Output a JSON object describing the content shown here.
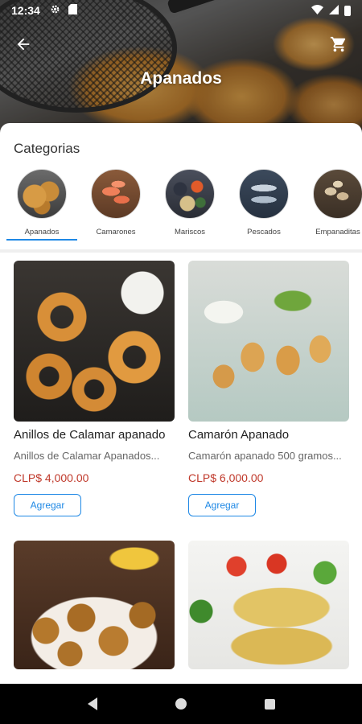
{
  "status_bar": {
    "time": "12:34"
  },
  "header": {
    "title": "Apanados"
  },
  "categories": {
    "heading": "Categorias",
    "items": [
      {
        "label": "Apanados",
        "selected": true
      },
      {
        "label": "Camarones",
        "selected": false
      },
      {
        "label": "Mariscos",
        "selected": false
      },
      {
        "label": "Pescados",
        "selected": false
      },
      {
        "label": "Empanaditas",
        "selected": false
      }
    ]
  },
  "products": [
    {
      "name": "Anillos de Calamar apanado",
      "description": "Anillos de Calamar Apanados...",
      "price": "CLP$ 4,000.00",
      "button": "Agregar"
    },
    {
      "name": "Camarón Apanado",
      "description": "Camarón apanado 500 gramos...",
      "price": "CLP$ 6,000.00",
      "button": "Agregar"
    }
  ],
  "colors": {
    "accent": "#1e88e5",
    "price": "#c0392b"
  }
}
